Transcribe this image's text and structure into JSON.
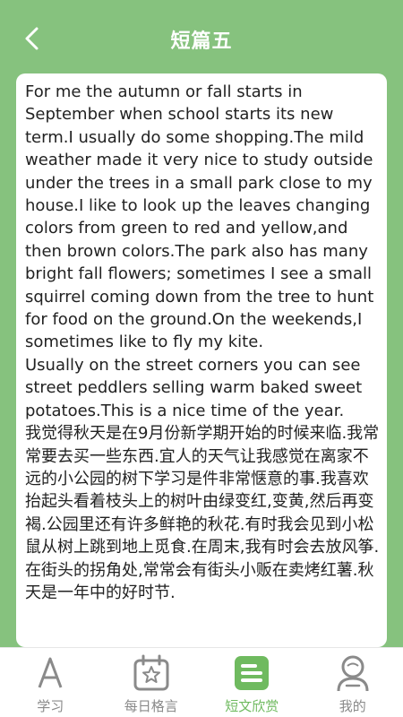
{
  "header": {
    "title": "短篇五"
  },
  "article": {
    "paragraphs": [
      "For me the autumn or fall starts in September when school starts its new term.I usually do some shopping.The mild weather made it very nice to study outside under the trees in a small park close to my house.I like to look up the leaves changing colors from green to red and yellow,and then brown colors.The park also has many bright fall flowers; sometimes I see a small squirrel coming down from the tree to hunt for food on the ground.On the weekends,I sometimes like to fly my kite.",
      "Usually on the street corners you can see street peddlers selling warm baked sweet potatoes.This is a nice time of the year.",
      "我觉得秋天是在9月份新学期开始的时候来临.我常常要去买一些东西.宜人的天气让我感觉在离家不远的小公园的树下学习是件非常惬意的事.我喜欢抬起头看着枝头上的树叶由绿变红,变黄,然后再变褐.公园里还有许多鲜艳的秋花.有时我会见到小松鼠从树上跳到地上觅食.在周末,我有时会去放风筝.在街头的拐角处,常常会有街头小贩在卖烤红薯.秋天是一年中的好时节."
    ]
  },
  "tabs": [
    {
      "label": "学习",
      "icon": "letter-a-icon",
      "active": false
    },
    {
      "label": "每日格言",
      "icon": "calendar-star-icon",
      "active": false
    },
    {
      "label": "短文欣赏",
      "icon": "document-icon",
      "active": true
    },
    {
      "label": "我的",
      "icon": "user-icon",
      "active": false
    }
  ],
  "colors": {
    "accent": "#86c27e",
    "active_tab": "#6fba5f",
    "inactive_tab": "#8a8a8a"
  }
}
